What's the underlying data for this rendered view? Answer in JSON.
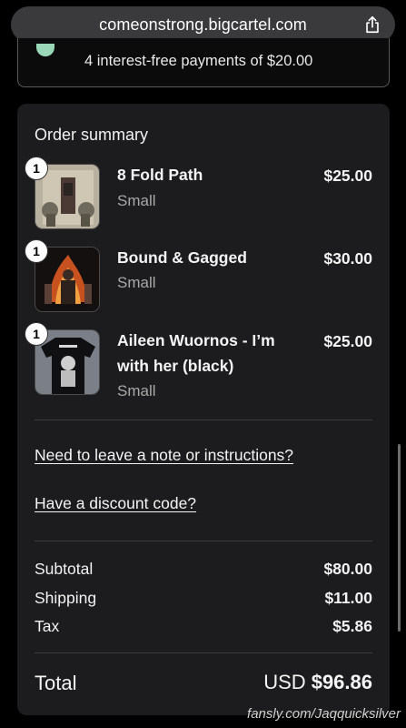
{
  "browser": {
    "url": "comeonstrong.bigcartel.com"
  },
  "payment_note": {
    "text": "4 interest-free payments of $20.00"
  },
  "order_summary": {
    "title": "Order summary",
    "items": [
      {
        "qty": "1",
        "name": "8 Fold Path",
        "variant": "Small",
        "price": "$25.00",
        "thumb": "8-fold-path-art"
      },
      {
        "qty": "1",
        "name": "Bound & Gagged",
        "variant": "Small",
        "price": "$30.00",
        "thumb": "bound-gagged-art"
      },
      {
        "qty": "1",
        "name": "Aileen Wuornos - I’m with her (black)",
        "variant": "Small",
        "price": "$25.00",
        "thumb": "black-tshirt"
      }
    ],
    "note_link": "Need to leave a note or instructions?",
    "discount_link": "Have a discount code?",
    "subtotal_label": "Subtotal",
    "subtotal_value": "$80.00",
    "shipping_label": "Shipping",
    "shipping_value": "$11.00",
    "tax_label": "Tax",
    "tax_value": "$5.86",
    "total_label": "Total",
    "total_currency": "USD",
    "total_value": "$96.86"
  },
  "watermark": "fansly.com/Jaqquicksilver",
  "icons": {
    "share": "share-icon",
    "check": "check-icon"
  }
}
